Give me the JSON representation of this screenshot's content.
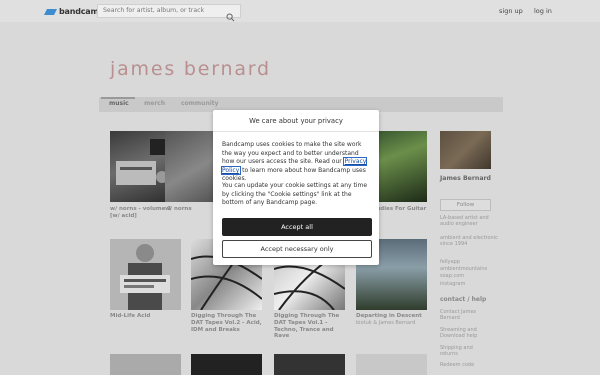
{
  "topbar": {
    "logo_text": "bandcamp",
    "search_placeholder": "Search for artist, album, or track",
    "signup": "sign up",
    "login": "log in"
  },
  "band": {
    "name": "james bernard",
    "tabs": [
      "music",
      "merch",
      "community"
    ]
  },
  "albums": [
    {
      "title": "w/ norns - volume 3 [w/ acid]",
      "sub": ""
    },
    {
      "title": "w/ norns",
      "sub": ""
    },
    {
      "title": "",
      "sub": ""
    },
    {
      "title": "...al Studies For Guitar & ...",
      "sub": ""
    },
    {
      "title": "Mid-Life Acid",
      "sub": ""
    },
    {
      "title": "Digging Through The DAT Tapes Vol.2 - Acid, IDM and Breaks",
      "sub": ""
    },
    {
      "title": "Digging Through The DAT Tapes Vol.1 - Techno, Trance and Rave",
      "sub": ""
    },
    {
      "title": "Departing in Descent",
      "sub": "biotuk & James Bernard"
    }
  ],
  "sidebar": {
    "name": "James Bernard",
    "follow": "Follow",
    "bio1": "LA-based artist and audio engineer",
    "bio2": "ambient and electronic since 1994",
    "links": [
      "fellyapp",
      "ambientmountains",
      "soap.com",
      "instagram"
    ],
    "contact_head": "contact / help",
    "contact_links": [
      "Contact James Bernard",
      "Streaming and Download help",
      "Shipping and returns",
      "Redeem code"
    ]
  },
  "modal": {
    "title": "We care about your privacy",
    "p1_before": "Bandcamp uses cookies to make the site work the way you expect and to better understand how our users access the site. Read our ",
    "p1_link": "Privacy Policy",
    "p1_after": " to learn more about how Bandcamp uses cookies.",
    "p2": "You can update your cookie settings at any time by clicking the \"Cookie settings\" link at the bottom of any Bandcamp page.",
    "accept_all": "Accept all",
    "accept_necessary": "Accept necessary only"
  },
  "colors": {
    "band_name": "#b98f8f",
    "accept_bg": "#222222",
    "link": "#1a4fa0"
  }
}
